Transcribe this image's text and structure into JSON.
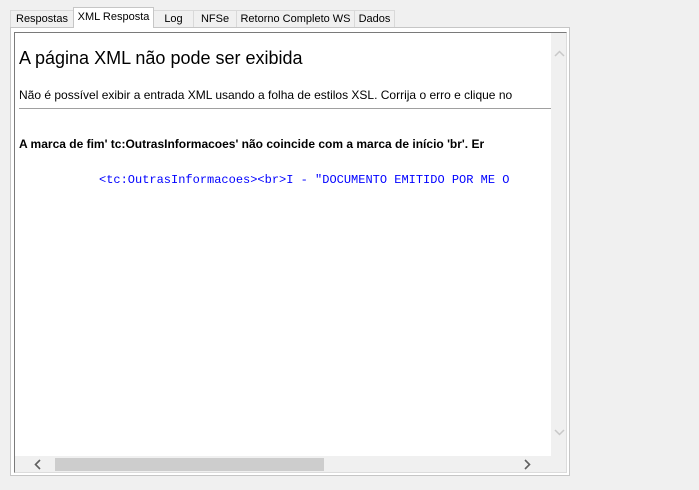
{
  "tabs": [
    {
      "label": "Respostas",
      "active": false
    },
    {
      "label": "XML Resposta",
      "active": true
    },
    {
      "label": "Log",
      "active": false
    },
    {
      "label": "NFSe",
      "active": false
    },
    {
      "label": "Retorno Completo WS",
      "active": false
    },
    {
      "label": "Dados",
      "active": false
    }
  ],
  "xml_error": {
    "title": "A página XML não pode ser exibida",
    "description": "Não é possível exibir a entrada XML usando a folha de estilos XSL. Corrija o erro e clique no",
    "reason": "A marca de fim' tc:OutrasInformacoes' não coincide com a marca de início 'br'. Er",
    "source_line": "<tc:OutrasInformacoes><br>I - \"DOCUMENTO EMITIDO POR ME O"
  },
  "icons": {
    "scroll_up": "chevron-up-icon",
    "scroll_down": "chevron-down-icon",
    "scroll_left": "chevron-left-icon",
    "scroll_right": "chevron-right-icon"
  },
  "colors": {
    "source_text": "#0000ff",
    "window_bg": "#f0f0f0"
  }
}
